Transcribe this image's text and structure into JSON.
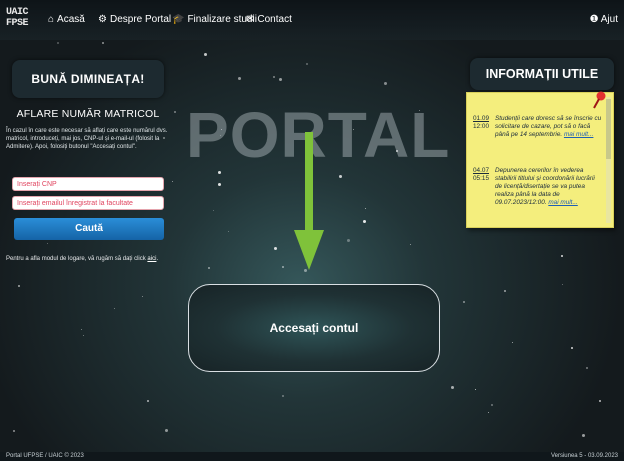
{
  "nav": {
    "logo_lines": [
      "UAIC",
      "FPSE"
    ],
    "items": [
      {
        "icon": "home-icon",
        "label": "Acasă"
      },
      {
        "icon": "gear-icon",
        "label": "Despre Portal"
      },
      {
        "icon": "graduation-cap-icon",
        "label": "Finalizare studii"
      },
      {
        "icon": "envelope-icon",
        "label": "Contact"
      }
    ],
    "help_label": "Ajut"
  },
  "left": {
    "greeting": "BUNĂ DIMINEAȚA!",
    "matricol_title": "AFLARE NUMĂR MATRICOL",
    "matricol_text": "În cazul în care este necesar să aflați care este numărul dvs. matricol, introduceți, mai jos, CNP-ul și e-mail-ul (folosit la Admitere). Apoi, folosiți butonul \"Accesați contul\".",
    "cnp_placeholder": "Inserați CNP",
    "email_placeholder": "Inserați emailul înregistrat la facultate",
    "search_label": "Caută",
    "footer_note": "Pentru a afla modul de logare, vă rugăm să dați click",
    "footer_link": "aici"
  },
  "center": {
    "watermark": "PORTAL",
    "login_label": "Accesați contul"
  },
  "right": {
    "title": "INFORMAȚII UTILE",
    "news": [
      {
        "date": "01.09",
        "time": "12:00",
        "text": "Studenții care doresc să se înscrie cu solicitare de cazare, pot să o facă până pe 14 septembrie.",
        "more": "mai mult..."
      },
      {
        "date": "04.07",
        "time": "05:15",
        "text": "Depunerea cererilor în vederea stabilirii titlului și coordonării lucrării de licență/disertație se va putea realiza până la data de 09.07.2023/12:00.",
        "more": "mai mult..."
      }
    ]
  },
  "bottom": {
    "left": "Portal UFPSE / UAIC © 2023",
    "right": "Versiunea 5 - 03.09.2023"
  }
}
